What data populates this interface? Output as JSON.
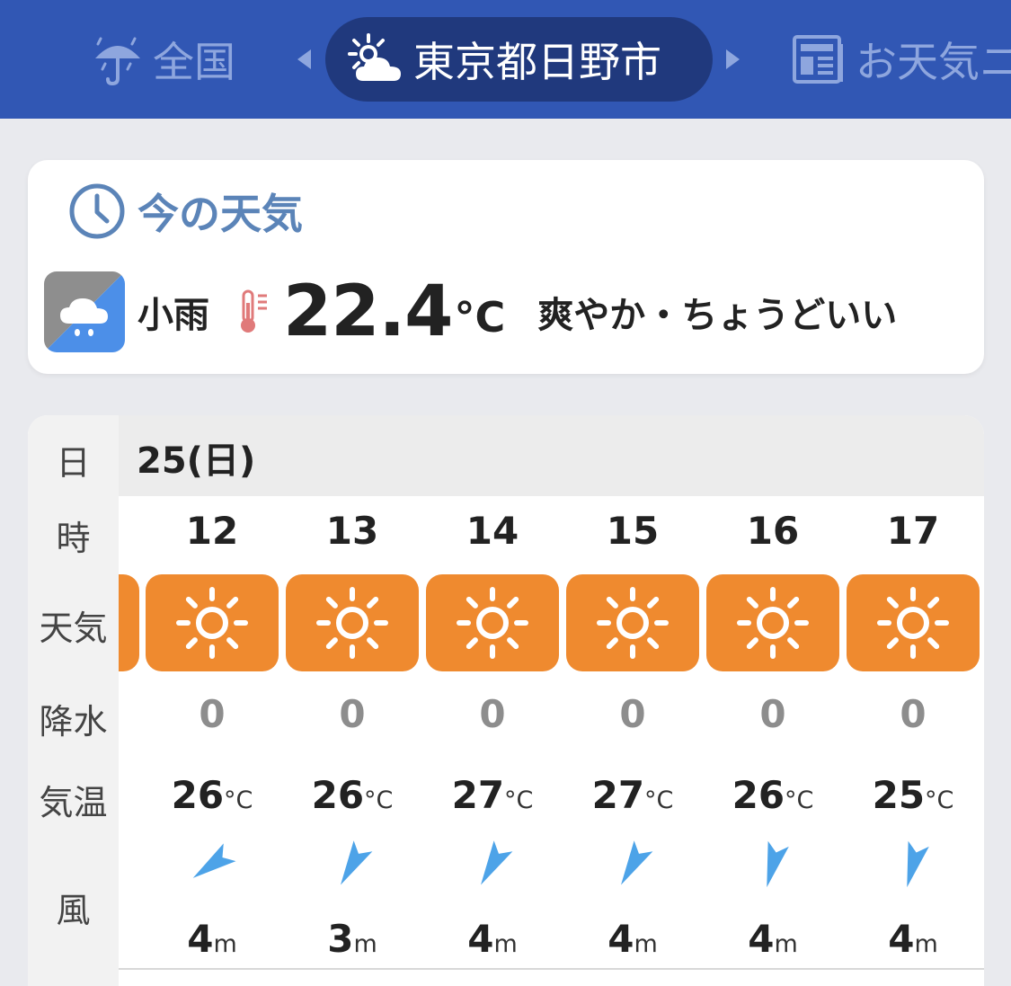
{
  "nav": {
    "national_label": "全国",
    "current_location": "東京都日野市",
    "news_label": "お天気ニ"
  },
  "now": {
    "title": "今の天気",
    "condition": "小雨",
    "temperature": "22.4",
    "temperature_unit": "°C",
    "feel": "爽やか・ちょうどいい"
  },
  "forecast": {
    "row_labels": {
      "day": "日",
      "hour": "時",
      "weather": "天気",
      "precip": "降水",
      "temp": "気温",
      "wind": "風"
    },
    "date": "25(日)",
    "temp_unit": "°C",
    "wind_unit": "m",
    "hours": [
      {
        "hour": "12",
        "weather_icon": "sun-icon",
        "precip": "0",
        "temp": "26",
        "wind_speed": "4",
        "wind_direction_deg": 35
      },
      {
        "hour": "13",
        "weather_icon": "sun-icon",
        "precip": "0",
        "temp": "26",
        "wind_speed": "3",
        "wind_direction_deg": 60
      },
      {
        "hour": "14",
        "weather_icon": "sun-icon",
        "precip": "0",
        "temp": "27",
        "wind_speed": "4",
        "wind_direction_deg": 60
      },
      {
        "hour": "15",
        "weather_icon": "sun-icon",
        "precip": "0",
        "temp": "27",
        "wind_speed": "4",
        "wind_direction_deg": 60
      },
      {
        "hour": "16",
        "weather_icon": "sun-icon",
        "precip": "0",
        "temp": "26",
        "wind_speed": "4",
        "wind_direction_deg": 75
      },
      {
        "hour": "17",
        "weather_icon": "sun-icon",
        "precip": "0",
        "temp": "25",
        "wind_speed": "4",
        "wind_direction_deg": 75
      }
    ]
  },
  "colors": {
    "nav_bg": "#3157b4",
    "nav_pill": "#20397d",
    "sunny_tile": "#ef8a2f",
    "wind_arrow": "#4da3e8",
    "title_blue": "#5b84b8"
  }
}
